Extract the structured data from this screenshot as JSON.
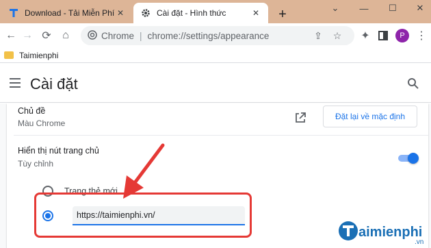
{
  "browser": {
    "tabs": [
      {
        "title": "Download - Tải Miễn Phí VN",
        "favicon": "taimienphi-t-icon",
        "active": false
      },
      {
        "title": "Cài đặt - Hình thức",
        "favicon": "gear-icon",
        "active": true
      }
    ],
    "window_controls": [
      "chevron-down-icon",
      "minimize-icon",
      "maximize-icon",
      "close-icon"
    ],
    "omnibox": {
      "site_label": "Chrome",
      "url": "chrome://settings/appearance"
    },
    "profile_initial": "P",
    "bookmarks": [
      {
        "label": "Taimienphi"
      }
    ]
  },
  "settings": {
    "header_title": "Cài đặt",
    "theme": {
      "title": "Chủ đề",
      "subtitle": "Màu Chrome",
      "reset_label": "Đặt lại về mặc định"
    },
    "home_button": {
      "title": "Hiển thị nút trang chủ",
      "subtitle": "Tùy chỉnh",
      "enabled": true,
      "options": [
        {
          "label": "Trang thẻ mới",
          "selected": false
        },
        {
          "label": "",
          "selected": true
        }
      ],
      "custom_url": "https://taimienphi.vn/"
    }
  },
  "watermark": {
    "text": "Taimienphi",
    "suffix": ".vn"
  },
  "colors": {
    "tabstrip": "#ddb597",
    "accent": "#1a73e8",
    "highlight": "#e53935",
    "brand": "#1a6fb5"
  }
}
